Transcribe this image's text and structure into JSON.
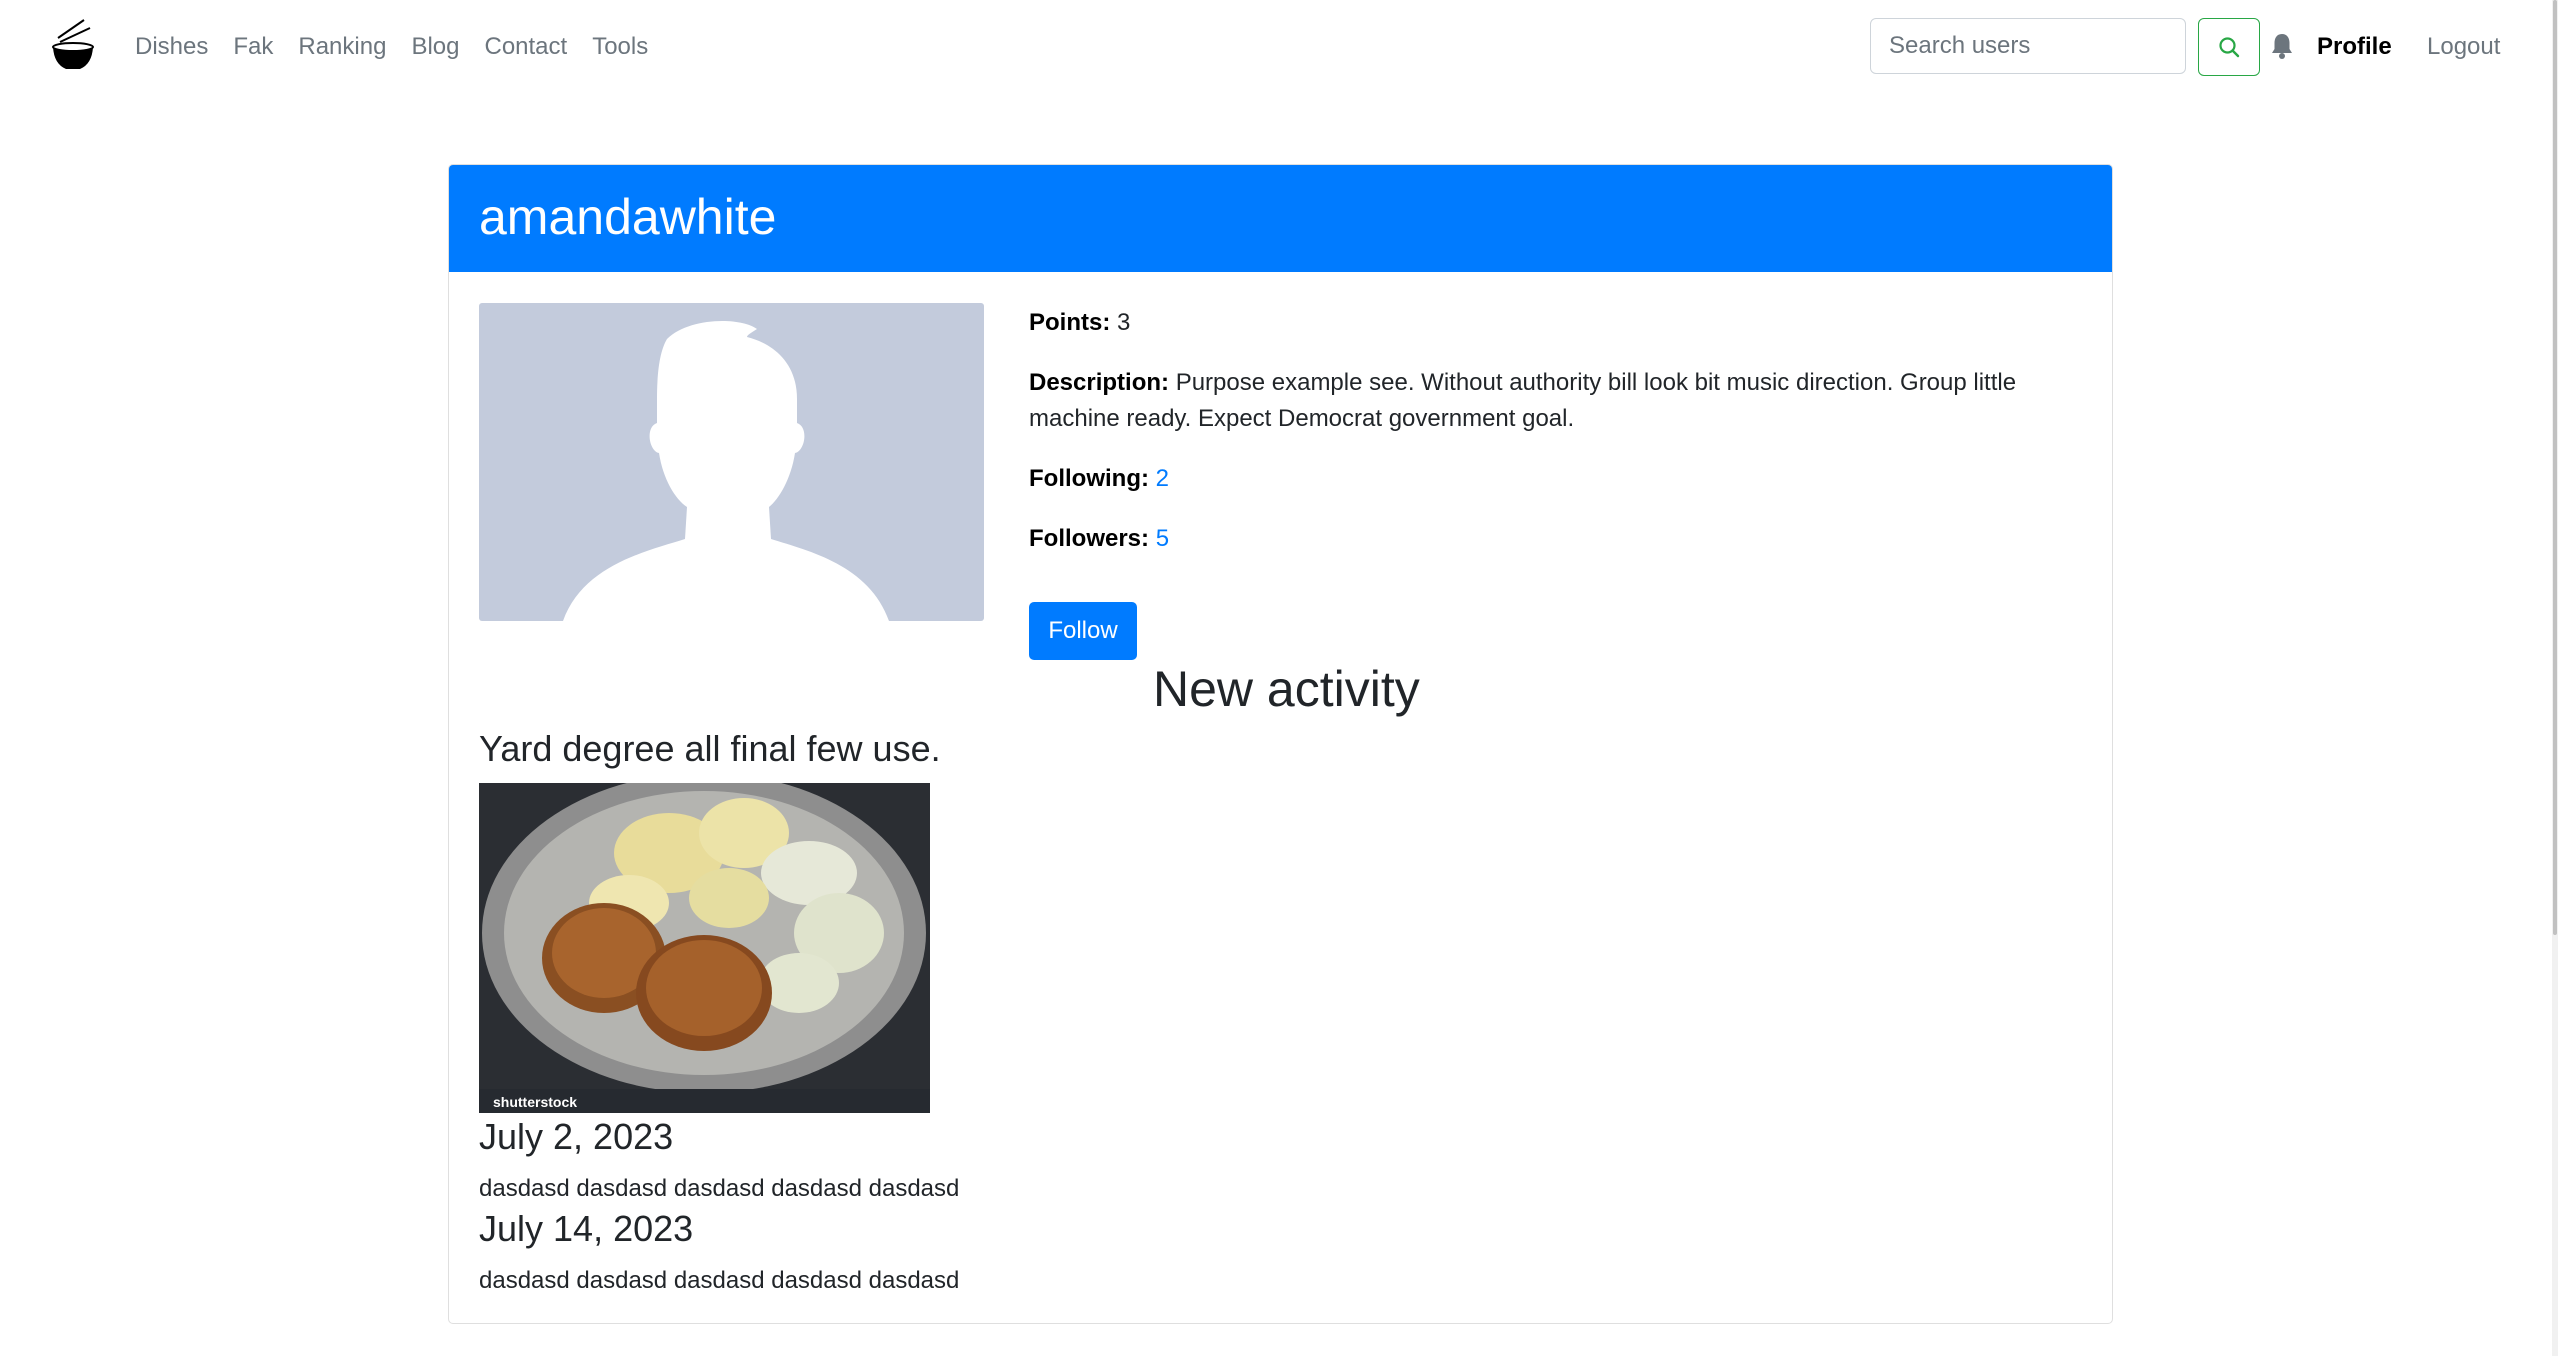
{
  "nav": {
    "links": [
      "Dishes",
      "Fak",
      "Ranking",
      "Blog",
      "Contact",
      "Tools"
    ],
    "search_placeholder": "Search users",
    "profile": "Profile",
    "logout": "Logout"
  },
  "profile": {
    "username": "amandawhite",
    "points_label": "Points:",
    "points": "3",
    "description_label": "Description:",
    "description": "Purpose example see. Without authority bill look bit music direction. Group little machine ready. Expect Democrat government goal.",
    "following_label": "Following:",
    "following": "2",
    "followers_label": "Followers:",
    "followers": "5",
    "follow_button": "Follow"
  },
  "activity": {
    "heading": "New activity",
    "post_title": "Yard degree all final few use.",
    "image_watermark": "shutterstock",
    "entries": [
      {
        "date": "July 2, 2023",
        "text": "dasdasd dasdasd dasdasd dasdasd dasdasd"
      },
      {
        "date": "July 14, 2023",
        "text": "dasdasd dasdasd dasdasd dasdasd dasdasd"
      }
    ]
  },
  "colors": {
    "primary": "#007bff",
    "success": "#28a745",
    "muted": "#6c757d",
    "avatar_bg": "#c3cbdc"
  }
}
